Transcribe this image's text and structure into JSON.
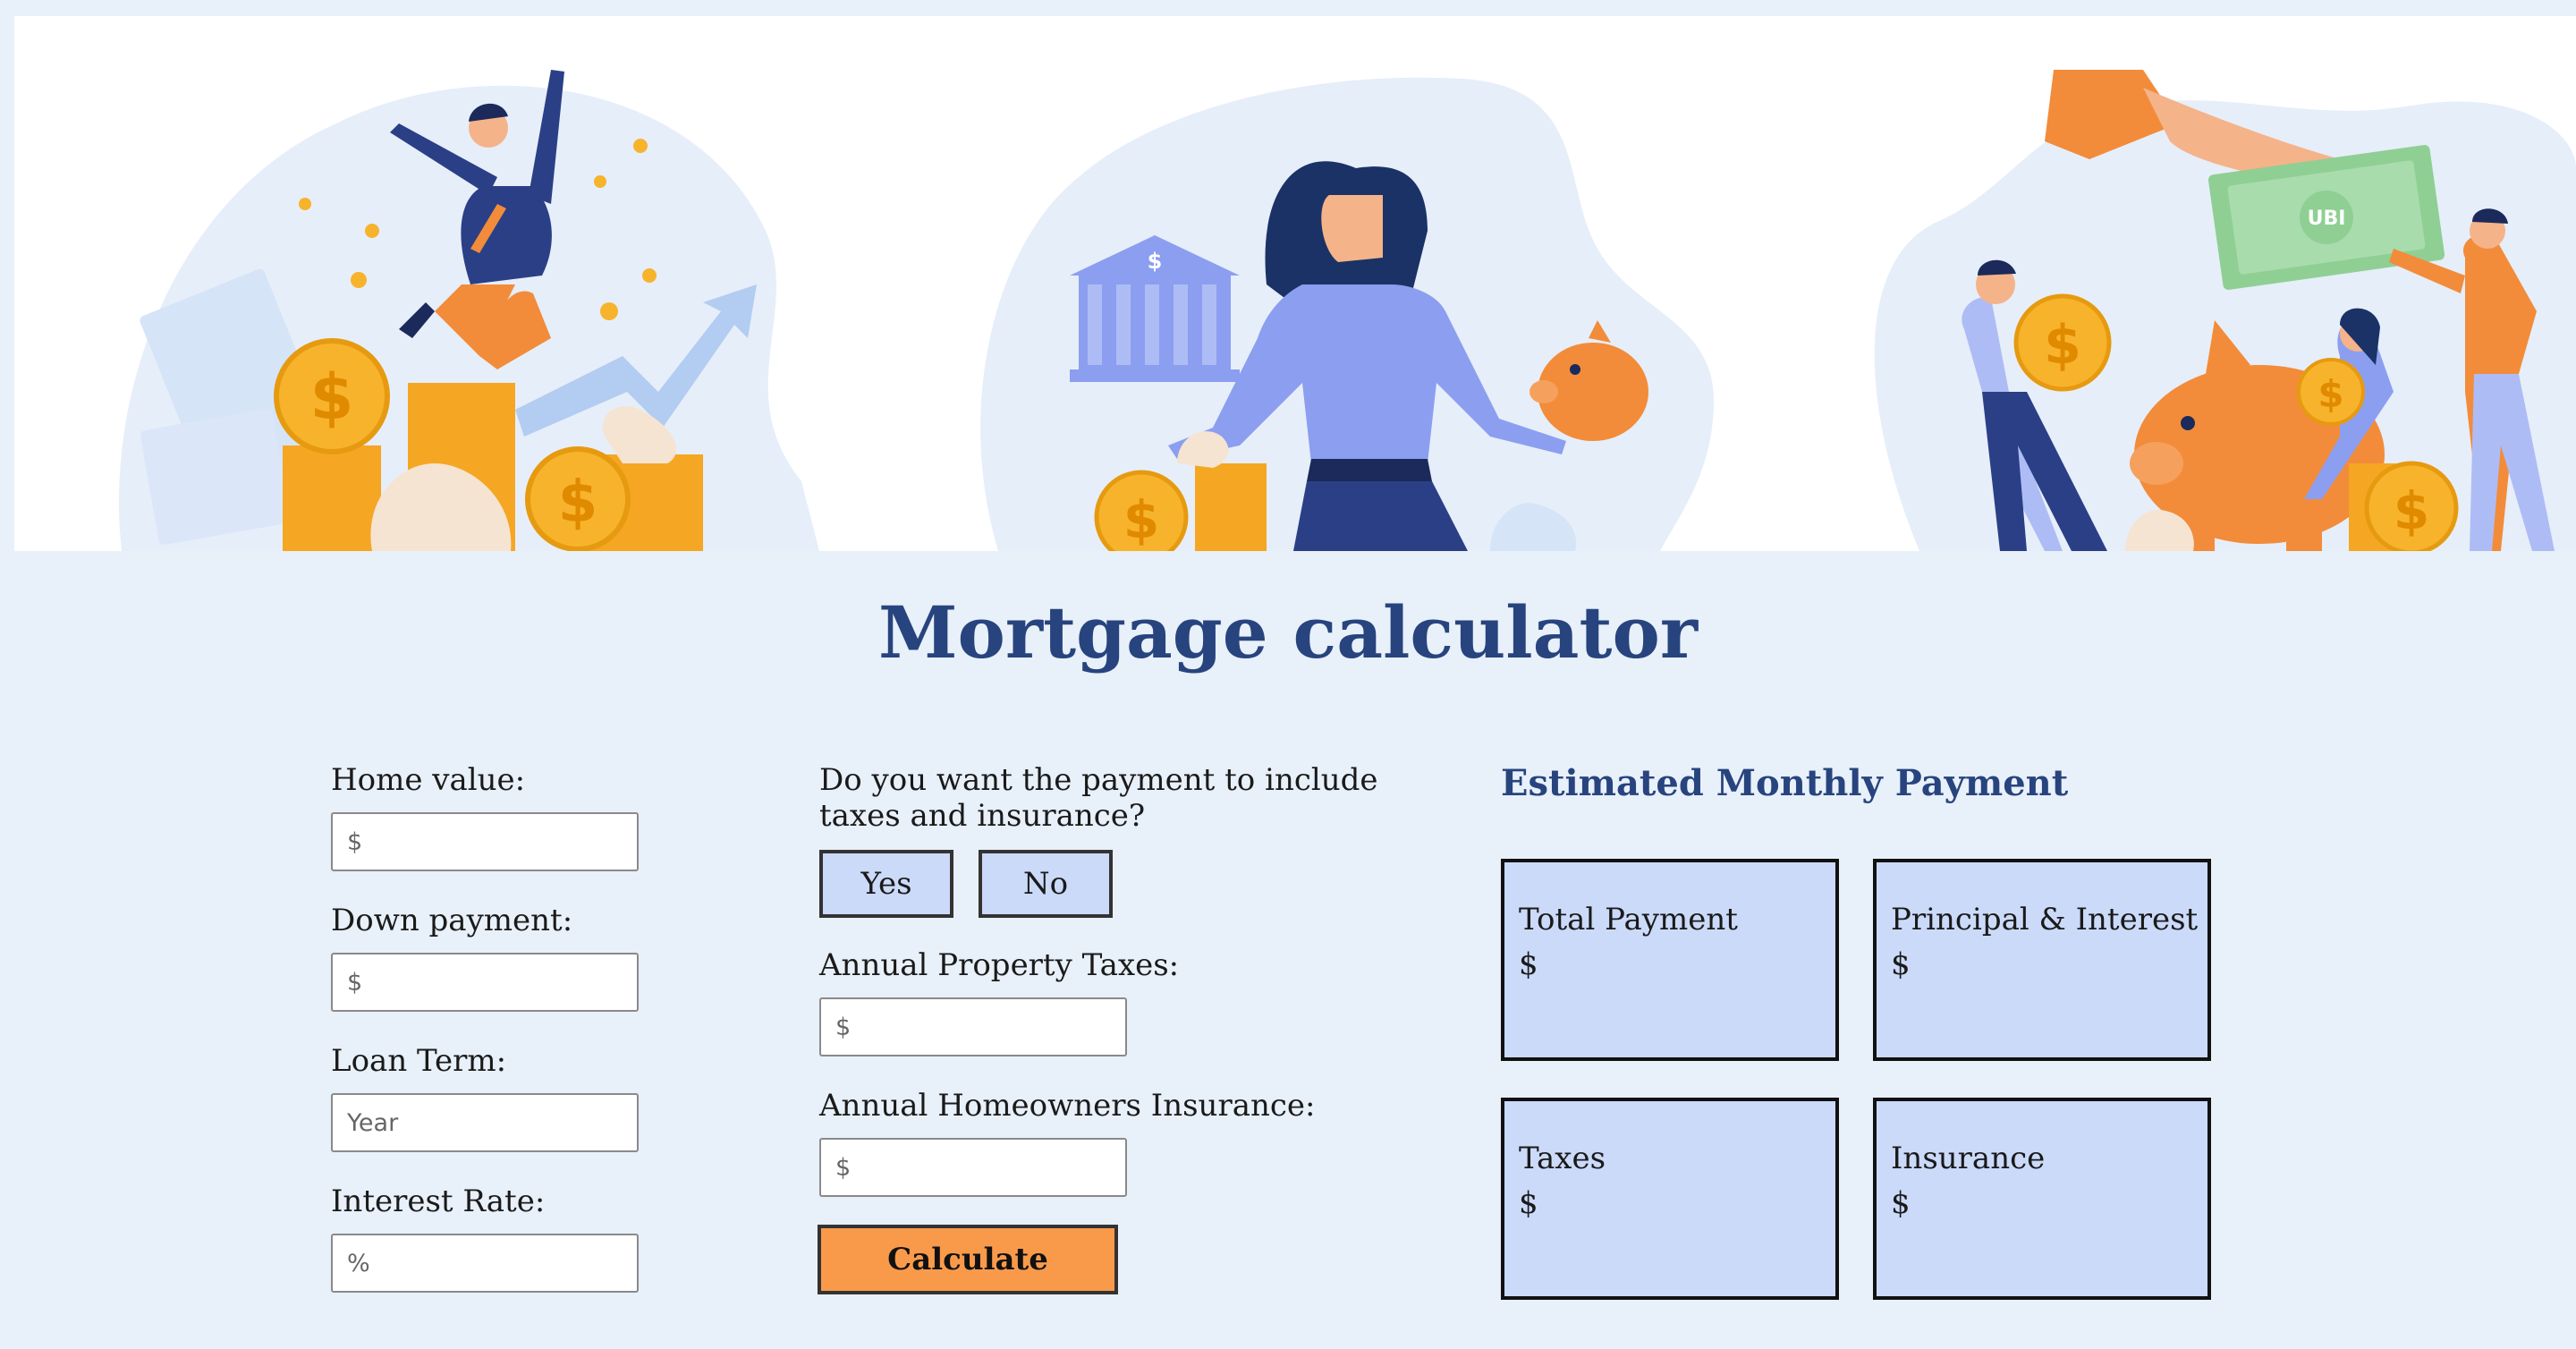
{
  "page": {
    "title": "Mortgage calculator"
  },
  "banner": {
    "scene_left": "celebrating-man-with-coins",
    "scene_center": "woman-with-bank-and-piggy-bank",
    "scene_right": "people-with-money-and-piggy-bank",
    "money_text": "UBI",
    "dollar_sign": "$"
  },
  "form": {
    "home_value": {
      "label": "Home value:",
      "placeholder": "$"
    },
    "down_payment": {
      "label": "Down payment:",
      "placeholder": "$"
    },
    "loan_term": {
      "label": "Loan Term:",
      "placeholder": "Year"
    },
    "interest_rate": {
      "label": "Interest Rate:",
      "placeholder": "%"
    },
    "include_question_line1": "Do you want the payment to include",
    "include_question_line2": "taxes and insurance?",
    "yes_label": "Yes",
    "no_label": "No",
    "property_taxes": {
      "label": "Annual Property Taxes:",
      "placeholder": "$"
    },
    "homeowners_insurance": {
      "label": "Annual Homeowners Insurance:",
      "placeholder": "$"
    },
    "calculate_label": "Calculate"
  },
  "results": {
    "heading": "Estimated Monthly Payment",
    "cards": [
      {
        "title": "Total Payment",
        "value": "$"
      },
      {
        "title": "Principal & Interest",
        "value": "$"
      },
      {
        "title": "Taxes",
        "value": "$"
      },
      {
        "title": "Insurance",
        "value": "$"
      }
    ]
  },
  "colors": {
    "background": "#e8f0f9",
    "title": "#28447e",
    "card_fill": "#cbdaf9",
    "calculate_button": "#f99a4b",
    "coin": "#f7b32b",
    "orange": "#f28c3a",
    "navy": "#2b3f86",
    "periwinkle": "#8c9ef0"
  }
}
